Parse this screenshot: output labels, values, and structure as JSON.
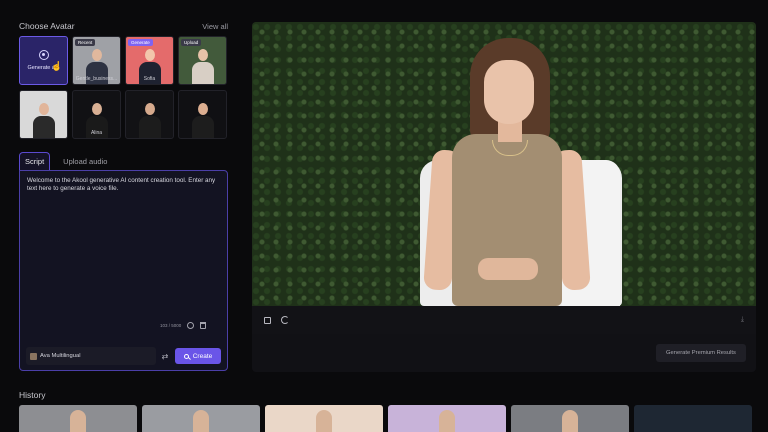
{
  "avatar_panel": {
    "title": "Choose Avatar",
    "view_all": "View all",
    "generate_label": "Generate a...",
    "tiles": [
      {
        "badge": "Recent",
        "caption": "Gentle_business...",
        "head": "#e0b89d",
        "body": "#2d3242",
        "bg": "#9fa1a6"
      },
      {
        "badge": "Generate",
        "caption": "Sofia",
        "head": "#f2c6ab",
        "body": "#1e2230",
        "bg": "#e46b6b"
      },
      {
        "badge": "Upload",
        "caption": "",
        "head": "#e8c2a8",
        "body": "#d8cfc5",
        "bg": "#425a3b"
      },
      {
        "badge": "",
        "caption": "",
        "head": "#e1b59a",
        "body": "#2a2a2a",
        "bg": "#d9d9d9"
      },
      {
        "badge": "",
        "caption": "Alina",
        "head": "#d9b094",
        "body": "#1a1a1a",
        "bg": "#111114"
      },
      {
        "badge": "",
        "caption": "",
        "head": "#d6aa8d",
        "body": "#1c1c1c",
        "bg": "#121215"
      },
      {
        "badge": "",
        "caption": "",
        "head": "#dcae90",
        "body": "#1d1d1d",
        "bg": "#101013"
      }
    ]
  },
  "script_panel": {
    "tabs": [
      "Script",
      "Upload audio"
    ],
    "text": "Welcome to the Akool generative AI content creation tool. Enter any text here to generate a voice file.",
    "counter": "103 / 5000",
    "voice": "Ava Multilingual",
    "create_label": "Create"
  },
  "preview_panel": {
    "premium_label": "Generate Premium Results"
  },
  "history": {
    "title": "History",
    "thumbs": [
      "#8d8e92",
      "#9a9ca1",
      "#ead7c8",
      "#c8b3d9",
      "#7b7d82",
      "#1e2733"
    ]
  },
  "colors": {
    "accent": "#6a55e8",
    "panel_bg": "#111115"
  }
}
